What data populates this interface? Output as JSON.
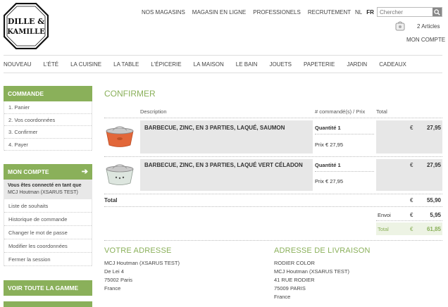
{
  "logo": {
    "line1": "DILLE &",
    "line2": "KAMILLE"
  },
  "topnav": [
    "NOS MAGASINS",
    "MAGASIN EN LIGNE",
    "PROFESSIONELS",
    "RECRUTEMENT"
  ],
  "lang": {
    "nl": "NL",
    "fr": "FR"
  },
  "search": {
    "placeholder": "Chercher"
  },
  "cart": {
    "count": "2 Articles"
  },
  "account_link": "MON COMPTE",
  "catnav": [
    "NOUVEAU",
    "L'ÉTÉ",
    "LA CUISINE",
    "LA TABLE",
    "L'ÉPICERIE",
    "LA MAISON",
    "LE BAIN",
    "JOUETS",
    "PAPETERIE",
    "JARDIN",
    "CADEAUX"
  ],
  "sidebar": {
    "commande_title": "COMMANDE",
    "steps": [
      "1. Panier",
      "2. Vos coordonnées",
      "3. Confirmer",
      "4. Payer"
    ],
    "compte_title": "MON COMPTE",
    "compte_arrow": "➔",
    "logged_label": "Vous êtes connecté en tant que",
    "logged_user": "MCJ Houtman (XSARUS TEST)",
    "account_items": [
      "Liste de souhaits",
      "Historique de commande",
      "Changer le mot de passe",
      "Modifier les coordonnées",
      "Fermer la session"
    ],
    "gamme_title": "VOIR TOUTE LA GAMME"
  },
  "main": {
    "title": "CONFIRMER",
    "headers": {
      "description": "Description",
      "qty": "# commandé(s) / Prix",
      "total": "Total"
    },
    "items": [
      {
        "name": "BARBECUE, ZINC, EN 3 PARTIES, LAQUÉ, SAUMON",
        "qty": "Quantité 1",
        "price": "Prix € 27,95",
        "currency": "€",
        "total": "27,95",
        "color": "#e2673a"
      },
      {
        "name": "BARBECUE, ZINC, EN 3 PARTIES, LAQUÉ VERT CÉLADON",
        "qty": "Quantité 1",
        "price": "Prix € 27,95",
        "currency": "€",
        "total": "27,95",
        "color": "#cdd9cf"
      }
    ],
    "subtotal": {
      "label": "Total",
      "currency": "€",
      "value": "55,90"
    },
    "shipping": {
      "label": "Envoi",
      "currency": "€",
      "value": "5,95"
    },
    "grand_total": {
      "label": "Total",
      "currency": "€",
      "value": "61,85"
    }
  },
  "addresses": {
    "billing_title": "VOTRE ADRESSE",
    "billing": [
      "MCJ Houtman (XSARUS TEST)",
      "De Lei 4",
      "75002 Paris",
      "France"
    ],
    "shipping_title": "ADRESSE DE LIVRAISON",
    "shipping": [
      "RODIER COLOR",
      "MCJ Houtman (XSARUS TEST)",
      "41 RUE RODIER",
      "75009 PARIS",
      "France"
    ]
  },
  "colors": {
    "accent": "#8ab05a",
    "row_bg": "#e7e7e7"
  }
}
